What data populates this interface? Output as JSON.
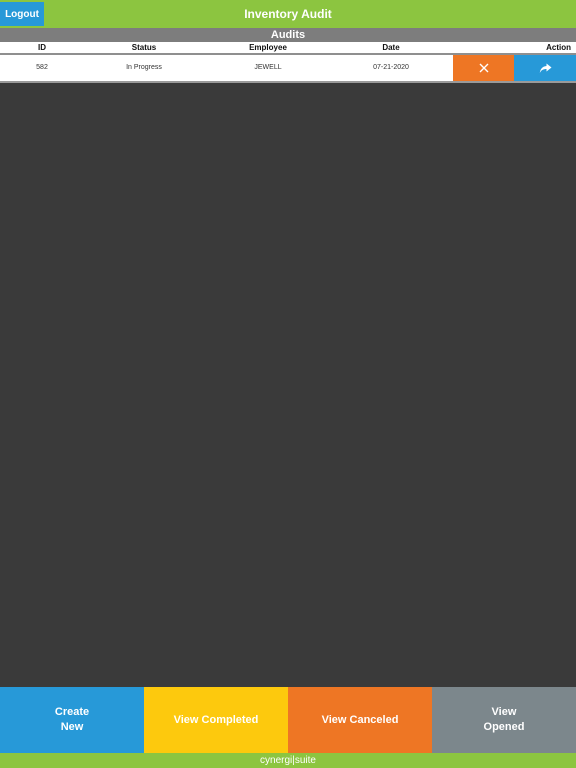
{
  "header": {
    "title": "Inventory Audit",
    "logout_label": "Logout"
  },
  "section": {
    "title": "Audits"
  },
  "table": {
    "columns": {
      "id": "ID",
      "status": "Status",
      "employee": "Employee",
      "date": "Date",
      "action": "Action"
    },
    "rows": [
      {
        "id": "582",
        "status": "In Progress",
        "employee": "JEWELL",
        "date": "07-21-2020"
      }
    ]
  },
  "actions": {
    "create_new": "Create\nNew",
    "view_completed": "View Completed",
    "view_canceled": "View Canceled",
    "view_opened": "View\nOpened"
  },
  "footer": {
    "brand": "cynergi|suite"
  },
  "colors": {
    "header_green": "#8cc540",
    "blue": "#2799d8",
    "orange": "#ee7624",
    "yellow": "#fdc90d",
    "gray": "#7c878c",
    "background": "#3a3a3a"
  },
  "icons": {
    "row_cancel": "close-icon",
    "row_open": "share-arrow-icon"
  }
}
